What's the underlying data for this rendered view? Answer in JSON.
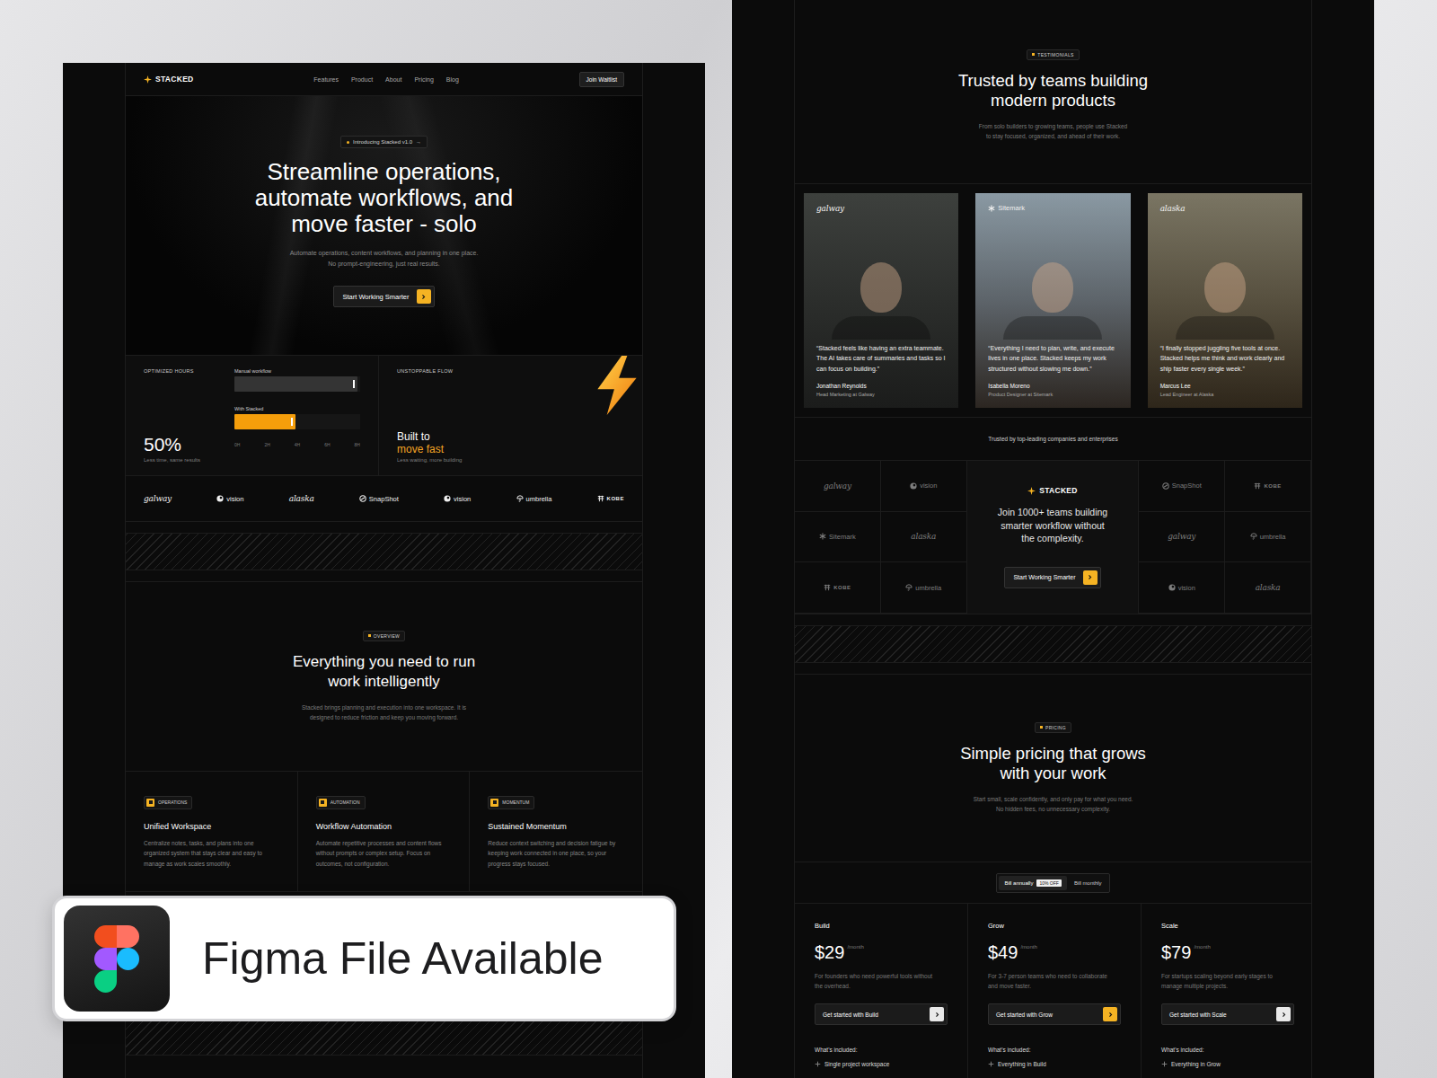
{
  "left_page": {
    "nav": {
      "brand": "STACKED",
      "links": [
        "Features",
        "Product",
        "About",
        "Pricing",
        "Blog"
      ],
      "cta": "Join Waitlist"
    },
    "hero": {
      "badge": "Introducing Stacked v1.0",
      "badge_arrow": "→",
      "title_lines": [
        "Streamline operations,",
        "automate workflows, and",
        "move faster - solo"
      ],
      "subtitle_lines": [
        "Automate operations, content workflows, and planning in one place.",
        "No prompt-engineering, just real results."
      ],
      "cta": "Start Working Smarter"
    },
    "stats": {
      "hours": {
        "label": "OPTIMIZED HOURS",
        "value": "50%",
        "caption": "Less time, same results",
        "axis_max": 8,
        "ticks": [
          "0H",
          "2H",
          "4H",
          "6H",
          "8H"
        ],
        "series": [
          {
            "label": "Manual workflow",
            "hours": 7.8,
            "color": "#343434"
          },
          {
            "label": "With Stacked",
            "hours": 3.9,
            "color": "#f59e0b"
          }
        ]
      },
      "flow": {
        "label": "UNSTOPPABLE FLOW",
        "title": "Built to",
        "accent": "move fast",
        "caption": "Less waiting, more building"
      }
    },
    "logos": [
      {
        "name": "galway",
        "kind": "script"
      },
      {
        "name": "vision",
        "kind": "dot"
      },
      {
        "name": "alaska",
        "kind": "script"
      },
      {
        "name": "SnapShot",
        "kind": "swirl"
      },
      {
        "name": "vision",
        "kind": "dot"
      },
      {
        "name": "umbrella",
        "kind": "umbrella"
      },
      {
        "name": "KOBE",
        "kind": "kobe"
      }
    ],
    "overview": {
      "badge": "OVERVIEW",
      "title_lines": [
        "Everything you need to run",
        "work intelligently"
      ],
      "text_lines": [
        "Stacked brings planning and execution into one workspace. It is",
        "designed to reduce friction and keep you moving forward."
      ]
    },
    "features": [
      {
        "tag": "OPERATIONS",
        "title": "Unified Workspace",
        "text": "Centralize notes, tasks, and plans into one organized system that stays clear and easy to manage as work scales smoothly."
      },
      {
        "tag": "AUTOMATION",
        "title": "Workflow Automation",
        "text": "Automate repetitive processes and content flows without prompts or complex setup. Focus on outcomes, not configuration."
      },
      {
        "tag": "MOMENTUM",
        "title": "Sustained Momentum",
        "text": "Reduce context switching and decision fatigue by keeping work connected in one place, so your progress stays focused."
      }
    ]
  },
  "right_page": {
    "testimonials": {
      "badge": "TESTIMONIALS",
      "title_lines": [
        "Trusted by teams building",
        "modern products"
      ],
      "text_lines": [
        "From solo builders to growing teams, people use Stacked",
        "to stay focused, organized, and ahead of their work."
      ],
      "cards": [
        {
          "company": "galway",
          "kind": "script",
          "quote": "“Stacked feels like having an extra teammate. The AI takes care of summaries and tasks so I can focus on building.”",
          "name": "Jonathan Reynolds",
          "role": "Head Marketing at Galway"
        },
        {
          "company": "Sitemark",
          "kind": "asterisk",
          "quote": "“Everything I need to plan, write, and execute lives in one place. Stacked keeps my work structured without slowing me down.”",
          "name": "Isabella Moreno",
          "role": "Product Designer at Sitemark"
        },
        {
          "company": "alaska",
          "kind": "script",
          "quote": "“I finally stopped juggling five tools at once. Stacked helps me think and work clearly and ship faster every single week.”",
          "name": "Marcus Lee",
          "role": "Lead Engineer at Alaska"
        }
      ]
    },
    "trusted": {
      "label": "Trusted by top-leading companies and enterprises",
      "logos": [
        {
          "name": "galway",
          "kind": "script"
        },
        {
          "name": "vision",
          "kind": "dot"
        },
        {
          "name": "SnapShot",
          "kind": "swirl"
        },
        {
          "name": "KOBE",
          "kind": "kobe"
        },
        {
          "name": "Sitemark",
          "kind": "asterisk"
        },
        {
          "name": "alaska",
          "kind": "script"
        },
        {
          "name": "galway",
          "kind": "script"
        },
        {
          "name": "umbrella",
          "kind": "umbrella"
        },
        {
          "name": "KOBE",
          "kind": "kobe"
        },
        {
          "name": "umbrella",
          "kind": "umbrella"
        },
        {
          "name": "vision",
          "kind": "dot"
        },
        {
          "name": "alaska",
          "kind": "script"
        }
      ],
      "cta_card": {
        "brand": "STACKED",
        "text_lines": [
          "Join 1000+ teams building",
          "smarter workflow without",
          "the complexity."
        ],
        "cta": "Start Working Smarter"
      }
    },
    "pricing": {
      "badge": "PRICING",
      "title_lines": [
        "Simple pricing that grows",
        "with your work"
      ],
      "text_lines": [
        "Start small, scale confidently, and only pay for what you need.",
        "No hidden fees, no unnecessary complexity."
      ],
      "billing": [
        {
          "label": "Bill annually",
          "tag": "10% OFF",
          "selected": true
        },
        {
          "label": "Bill monthly",
          "tag": "",
          "selected": false
        }
      ],
      "plans": [
        {
          "name": "Build",
          "price": "$29",
          "period": "/month",
          "text": "For founders who need powerful tools without the overhead.",
          "cta": "Get started with Build",
          "included_label": "What's included:",
          "items": [
            "Single project workspace"
          ],
          "featured": false
        },
        {
          "name": "Grow",
          "price": "$49",
          "period": "/month",
          "text": "For 3-7 person teams who need to collaborate and move faster.",
          "cta": "Get started with Grow",
          "included_label": "What's included:",
          "items": [
            "Everything in Build"
          ],
          "featured": true
        },
        {
          "name": "Scale",
          "price": "$79",
          "period": "/month",
          "text": "For startups scaling beyond early stages to manage multiple projects.",
          "cta": "Get started with Scale",
          "included_label": "What's included:",
          "items": [
            "Everything in Grow"
          ],
          "featured": false
        }
      ]
    }
  },
  "promo": {
    "label": "Figma File Available"
  }
}
